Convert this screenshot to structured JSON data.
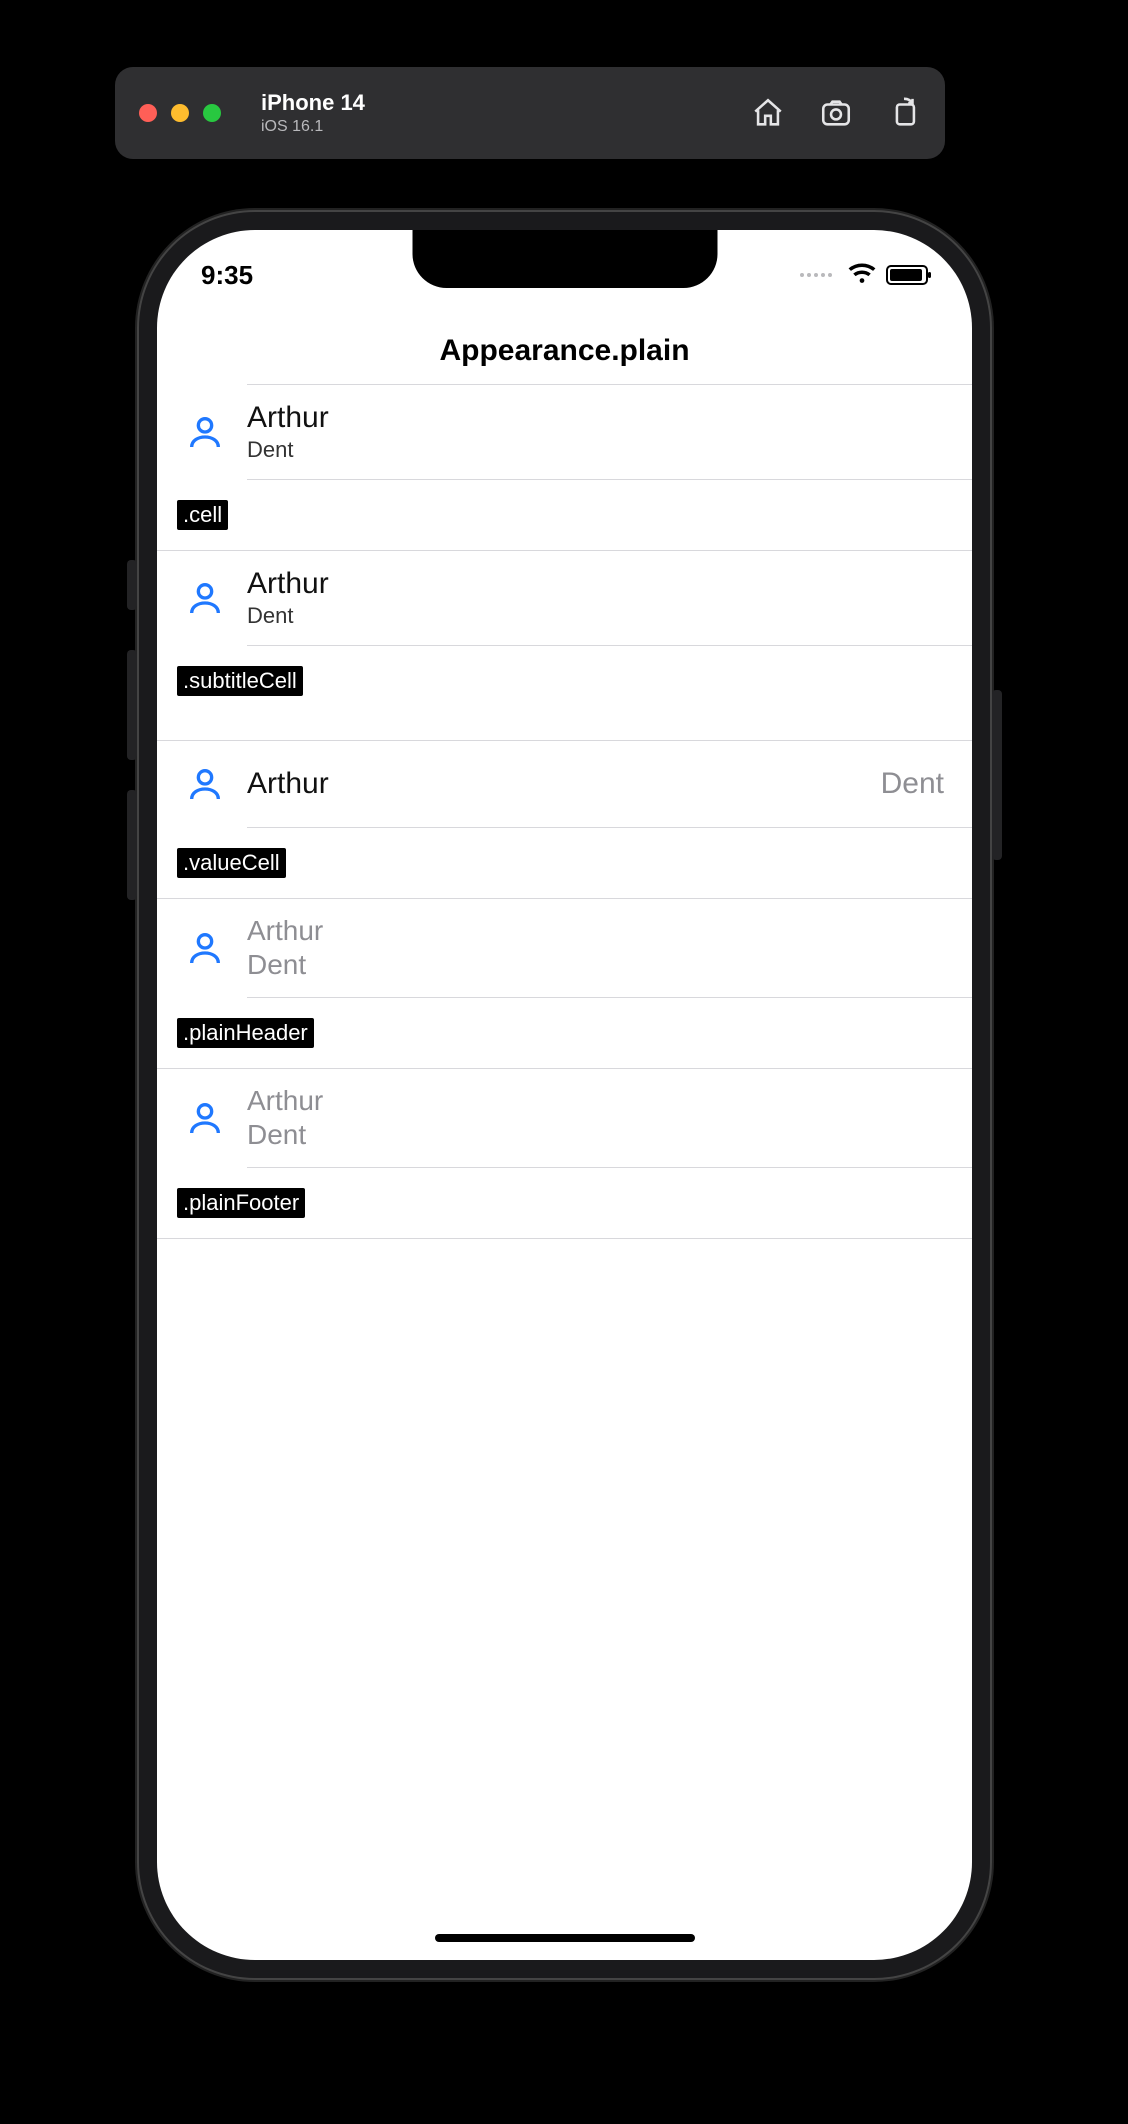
{
  "simulator": {
    "device": "iPhone 14",
    "os": "iOS 16.1"
  },
  "status": {
    "time": "9:35"
  },
  "nav": {
    "title": "Appearance.plain"
  },
  "sections": {
    "cell": {
      "title": "Arthur",
      "subtitle": "Dent",
      "tag": ".cell"
    },
    "subtitleCell": {
      "title": "Arthur",
      "subtitle": "Dent",
      "tag": ".subtitleCell"
    },
    "valueCell": {
      "title": "Arthur",
      "value": "Dent",
      "tag": ".valueCell"
    },
    "plainHeader": {
      "title": "Arthur",
      "subtitle": "Dent",
      "tag": ".plainHeader"
    },
    "plainFooter": {
      "title": "Arthur",
      "subtitle": "Dent",
      "tag": ".plainFooter"
    }
  }
}
